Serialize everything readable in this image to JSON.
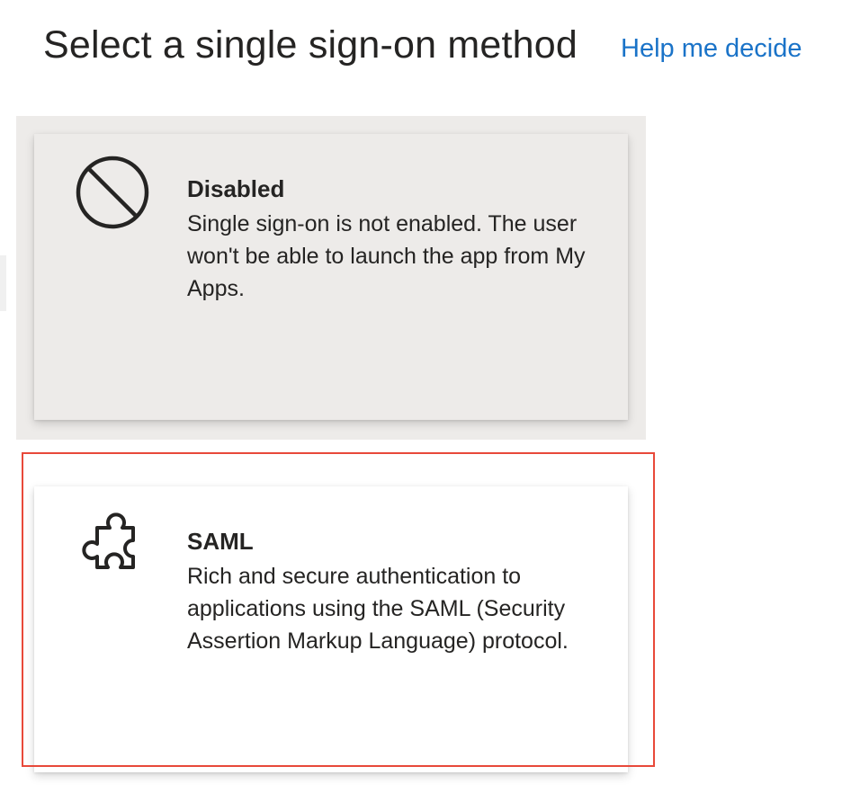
{
  "header": {
    "title": "Select a single sign-on method",
    "help_link": "Help me decide"
  },
  "cards": [
    {
      "icon": "prohibited-icon",
      "title": "Disabled",
      "description": "Single sign-on is not enabled. The user won't be able to launch the app from My Apps.",
      "state": "hovered"
    },
    {
      "icon": "puzzle-piece-icon",
      "title": "SAML",
      "description": "Rich and secure authentication to applications using the SAML (Security Assertion Markup Language) protocol.",
      "state": "highlighted"
    }
  ],
  "colors": {
    "link": "#1a73c8",
    "hover_background": "#edebe9",
    "highlight_border": "#e8493a",
    "text": "#252423"
  }
}
